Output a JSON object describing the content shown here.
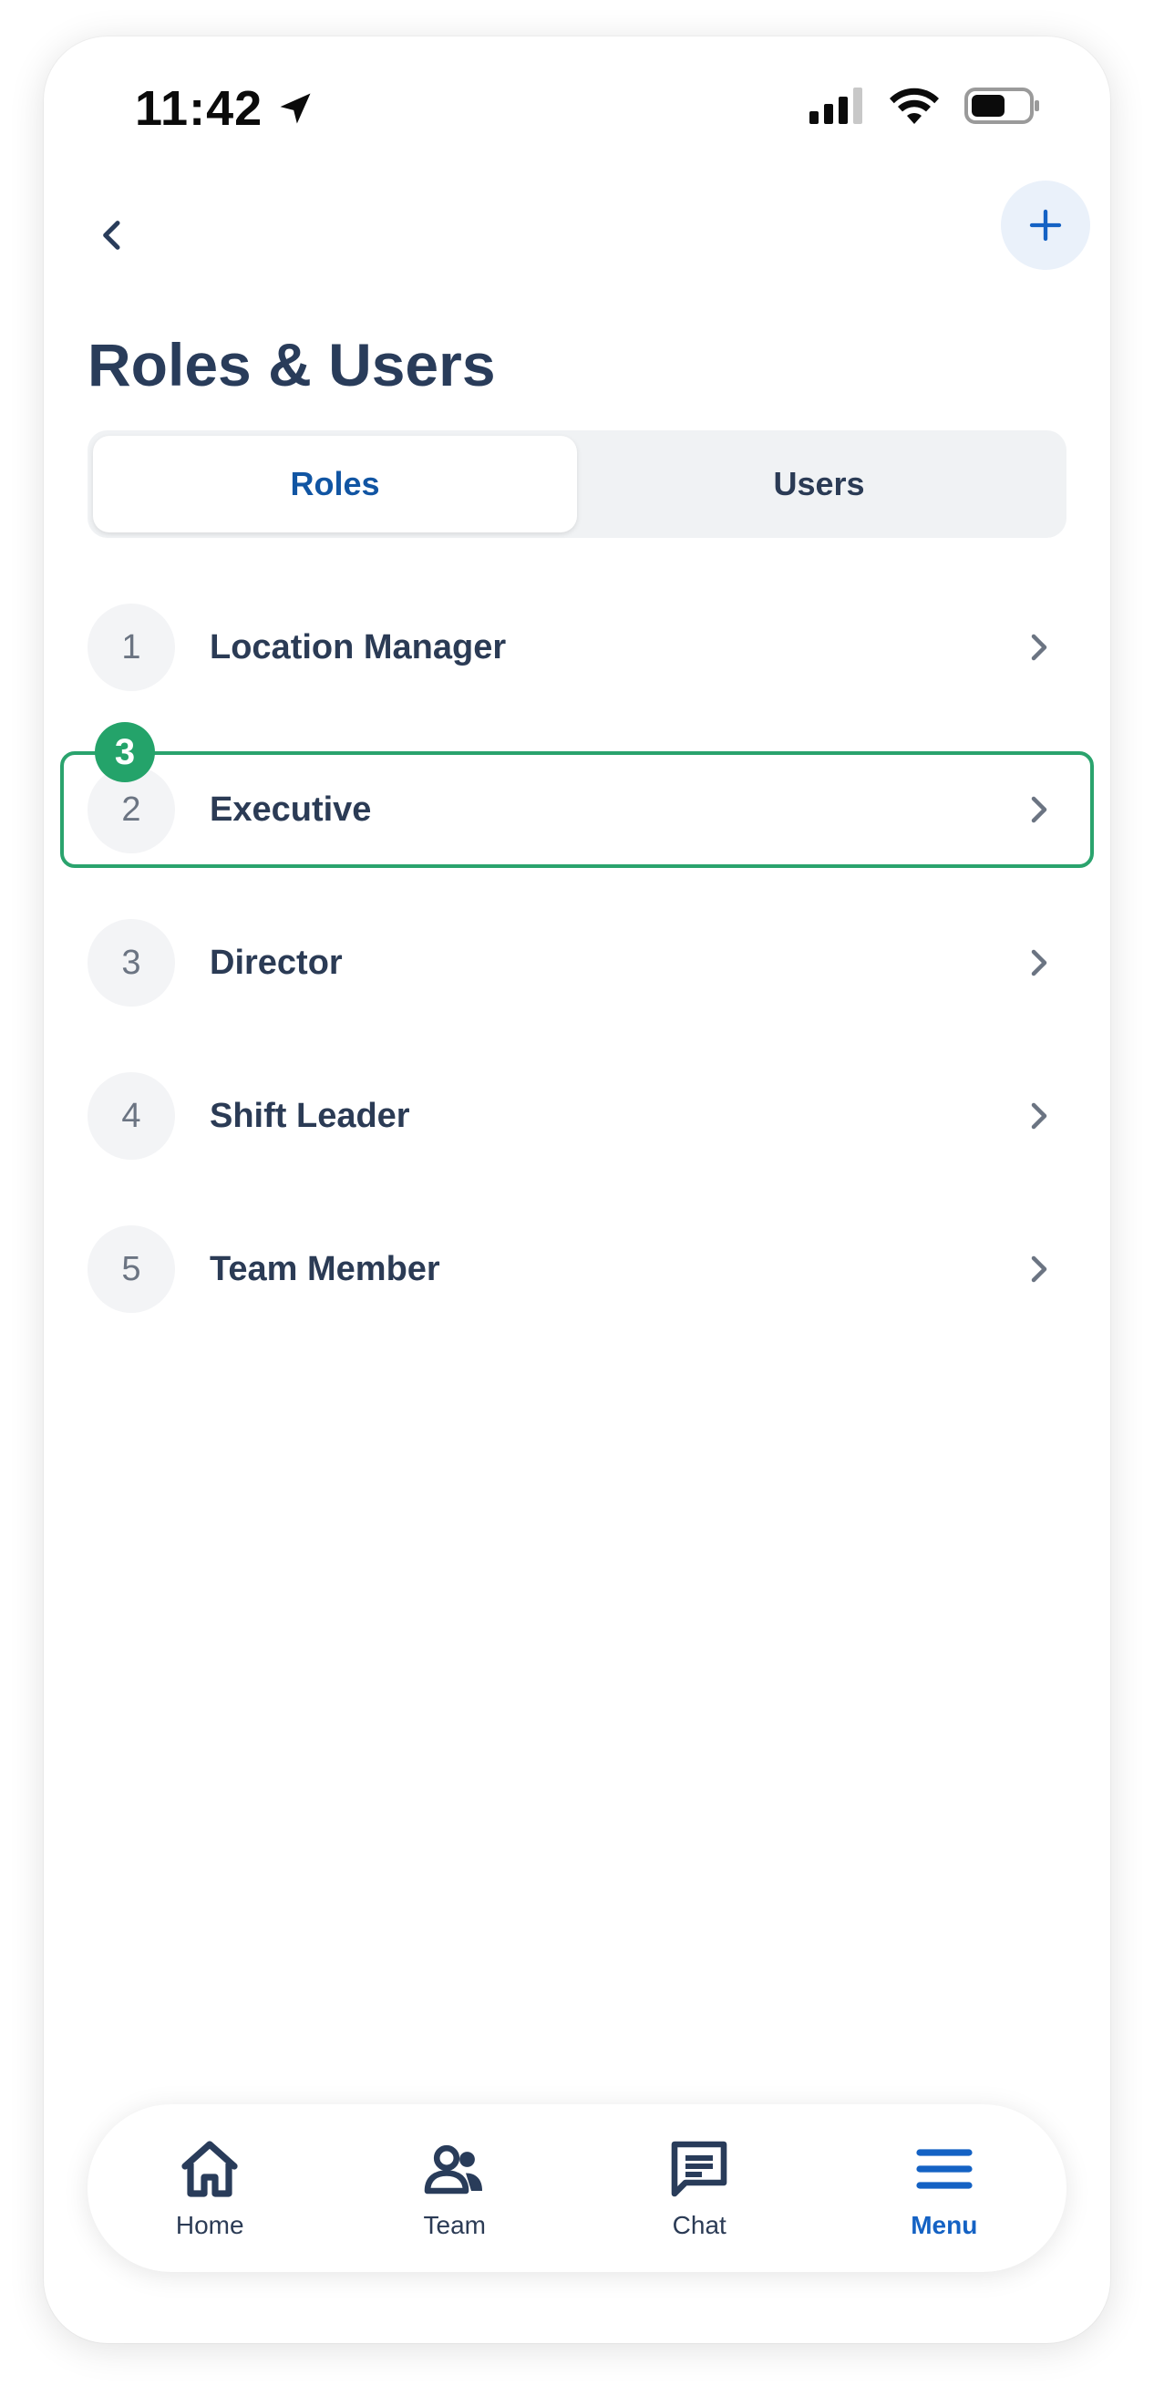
{
  "status_bar": {
    "time": "11:42"
  },
  "header": {
    "title": "Roles & Users"
  },
  "tabs": [
    {
      "label": "Roles",
      "active": true
    },
    {
      "label": "Users",
      "active": false
    }
  ],
  "roles": [
    {
      "number": "1",
      "name": "Location Manager"
    },
    {
      "number": "2",
      "name": "Executive"
    },
    {
      "number": "3",
      "name": "Director"
    },
    {
      "number": "4",
      "name": "Shift Leader"
    },
    {
      "number": "5",
      "name": "Team Member"
    }
  ],
  "step_badge": "3",
  "bottom_nav": [
    {
      "label": "Home",
      "icon": "home-icon",
      "active": false
    },
    {
      "label": "Team",
      "icon": "team-icon",
      "active": false
    },
    {
      "label": "Chat",
      "icon": "chat-icon",
      "active": false
    },
    {
      "label": "Menu",
      "icon": "menu-icon",
      "active": true
    }
  ],
  "colors": {
    "accent": "#1462c4",
    "title": "#293c5a",
    "highlight": "#2aa36d"
  }
}
